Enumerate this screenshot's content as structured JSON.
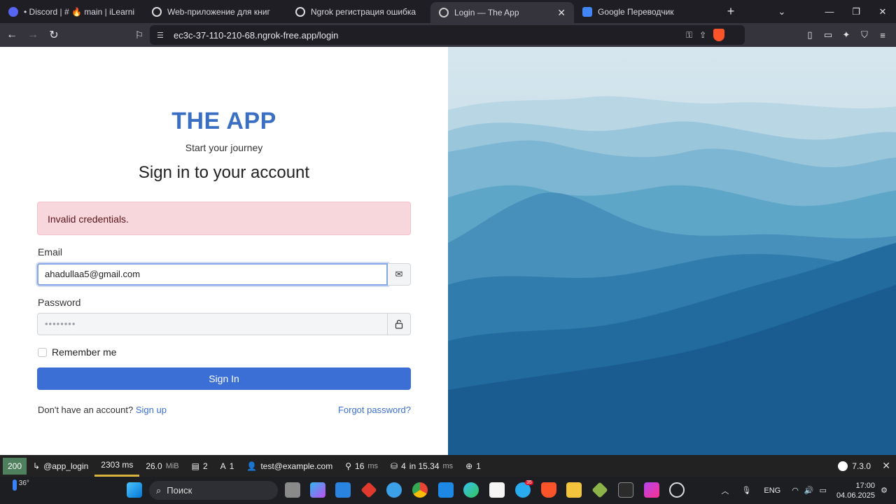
{
  "browser": {
    "tabs": [
      {
        "title": "• Discord | # 🔥 main | iLearning",
        "active": false
      },
      {
        "title": "Web-приложение для книг",
        "active": false
      },
      {
        "title": "Ngrok регистрация ошибка",
        "active": false
      },
      {
        "title": "Login — The App",
        "active": true
      },
      {
        "title": "Google Переводчик",
        "active": false
      }
    ],
    "new_tab": "+",
    "url": "ec3c-37-110-210-68.ngrok-free.app/login"
  },
  "login": {
    "brand": "THE APP",
    "tagline": "Start your journey",
    "heading": "Sign in to your account",
    "alert": "Invalid credentials.",
    "email_label": "Email",
    "email_value": "ahadullaa5@gmail.com",
    "password_label": "Password",
    "password_value": "••••••••",
    "remember_label": "Remember me",
    "signin_label": "Sign In",
    "no_account_text": "Don't have an account?",
    "signup_link": "Sign up",
    "forgot_link": "Forgot password?"
  },
  "debug": {
    "status": "200",
    "route": "@app_login",
    "time": "2303 ms",
    "memory": "26.0",
    "memory_unit": "MiB",
    "forms": "2",
    "translations": "1",
    "user": "test@example.com",
    "twig": "16",
    "twig_unit": "ms",
    "db": "4",
    "db_in": "in 15.34",
    "db_unit": "ms",
    "logs": "1",
    "version": "7.3.0"
  },
  "taskbar": {
    "temperature": "36°",
    "search_label": "Поиск",
    "language": "ENG",
    "time": "17:00",
    "date": "04.06.2025",
    "telegram_badge": "35"
  },
  "colors": {
    "brand": "#3b6fc4",
    "primary": "#3b6fd6",
    "alert_bg": "#f7d7dc",
    "debug_ok": "#4f805d"
  }
}
